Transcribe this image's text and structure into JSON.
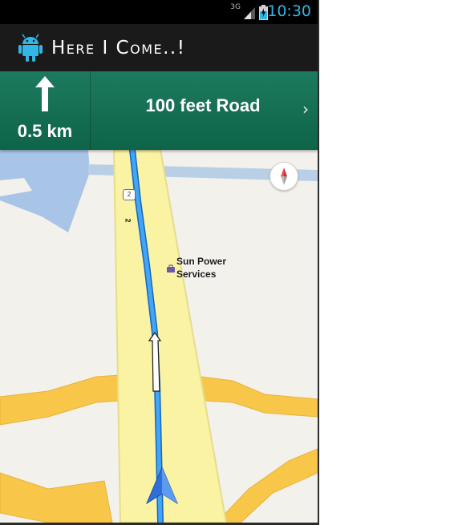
{
  "status_bar": {
    "network": "3G",
    "time": "10:30"
  },
  "action_bar": {
    "app_title": "Here I Come..!",
    "app_icon": "android-robot-icon"
  },
  "navigation": {
    "maneuver_icon": "straight-arrow-icon",
    "distance": "0.5 km",
    "street_name": "100 feet Road",
    "next_icon": "chevron-right-icon"
  },
  "map": {
    "poi_name": "Sun Power Services",
    "route_shield": "2",
    "route_number": "2",
    "compass_icon": "compass-icon",
    "location_icon": "navigation-arrow-icon"
  },
  "colors": {
    "status_time": "#33b5e5",
    "nav_banner": "#146f52",
    "route_line": "#2196f3",
    "main_road": "#f9f1a0",
    "side_road": "#f8c74a",
    "water": "#a8c4e6"
  }
}
